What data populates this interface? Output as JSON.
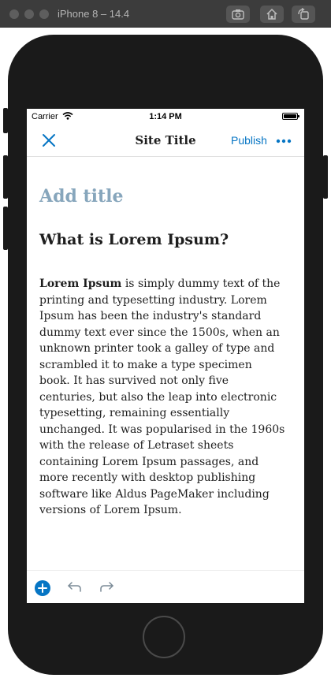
{
  "simulator": {
    "title": "iPhone 8 – 14.4",
    "buttons": [
      "screenshot-icon",
      "home-icon",
      "rotate-icon"
    ]
  },
  "status_bar": {
    "carrier": "Carrier",
    "time": "1:14 PM",
    "wifi_icon": "wifi-icon",
    "battery_icon": "battery-icon",
    "battery_level": 1.0
  },
  "nav": {
    "close_icon": "close-icon",
    "title": "Site Title",
    "publish_label": "Publish",
    "more_icon": "more-icon"
  },
  "editor": {
    "title_placeholder": "Add title",
    "heading": "What is Lorem Ipsum?",
    "paragraph_bold": "Lorem Ipsum",
    "paragraph_rest": " is simply dummy text of the printing and typesetting industry. Lorem Ipsum has been the industry's standard dummy text ever since the 1500s, when an unknown printer took a galley of type and scrambled it to make a type specimen book. It has survived not only five centuries, but also the leap into electronic typesetting, remaining essentially unchanged. It was popularised in the 1960s with the release of Letraset sheets containing Lorem Ipsum passages, and more recently with desktop publishing software like Aldus PageMaker including versions of Lorem Ipsum."
  },
  "toolbar": {
    "add_block_icon": "add-block-icon",
    "undo_icon": "undo-icon",
    "redo_icon": "redo-icon"
  },
  "colors": {
    "accent": "#0675c4",
    "title_placeholder": "#87a6bc",
    "text": "#1e1e1e",
    "simulator_chrome": "#3c3c3c",
    "device_body": "#1a1a1a"
  }
}
